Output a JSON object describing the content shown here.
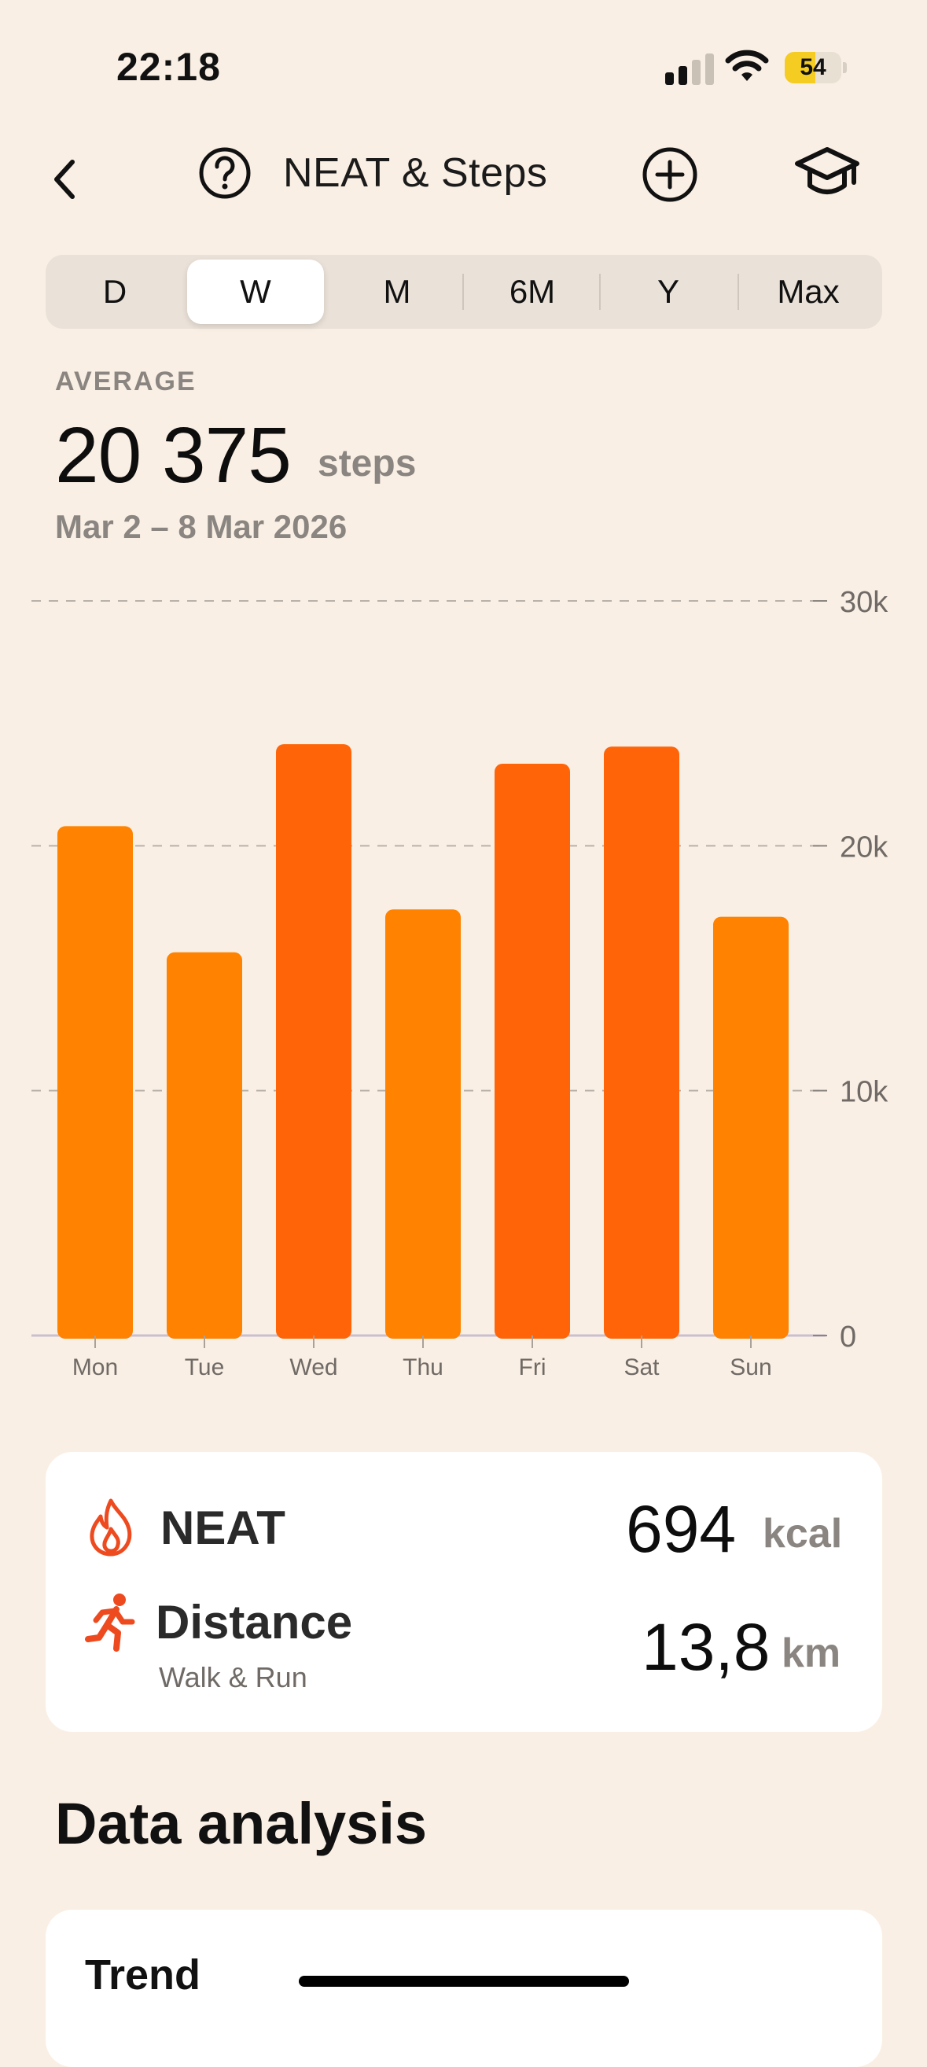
{
  "status_bar": {
    "time": "22:18",
    "battery_level": "54"
  },
  "nav": {
    "title": "NEAT & Steps"
  },
  "segments": [
    {
      "label": "D",
      "active": false
    },
    {
      "label": "W",
      "active": true
    },
    {
      "label": "M",
      "active": false
    },
    {
      "label": "6M",
      "active": false
    },
    {
      "label": "Y",
      "active": false
    },
    {
      "label": "Max",
      "active": false
    }
  ],
  "summary": {
    "label": "AVERAGE",
    "value": "20 375",
    "unit": "steps",
    "range": "Mar 2 – 8 Mar 2026"
  },
  "chart_data": {
    "type": "bar",
    "categories": [
      "Mon",
      "Tue",
      "Wed",
      "Thu",
      "Fri",
      "Sat",
      "Sun"
    ],
    "values": [
      20800,
      15650,
      24150,
      17400,
      23350,
      24050,
      17100
    ],
    "ylim": [
      0,
      30000
    ],
    "y_ticks": [
      {
        "value": 0,
        "label": "0"
      },
      {
        "value": 10000,
        "label": "10k"
      },
      {
        "value": 20000,
        "label": "20k"
      },
      {
        "value": 30000,
        "label": "30k"
      }
    ],
    "y_axis_position": "right",
    "grid": true,
    "bar_color": "#FF8200",
    "bar_color_high": "#FF6508"
  },
  "metrics": {
    "neat": {
      "label": "NEAT",
      "value": "694",
      "unit": "kcal",
      "icon": "flame-icon"
    },
    "distance": {
      "label": "Distance",
      "sublabel": "Walk & Run",
      "value": "13,8",
      "unit": "km",
      "icon": "running-person-icon"
    }
  },
  "sections": {
    "analysis_title": "Data analysis",
    "trend_title": "Trend"
  },
  "colors": {
    "background": "#FAEFE4",
    "accent": "#FF6A00",
    "icon_red": "#EE4A1F"
  }
}
